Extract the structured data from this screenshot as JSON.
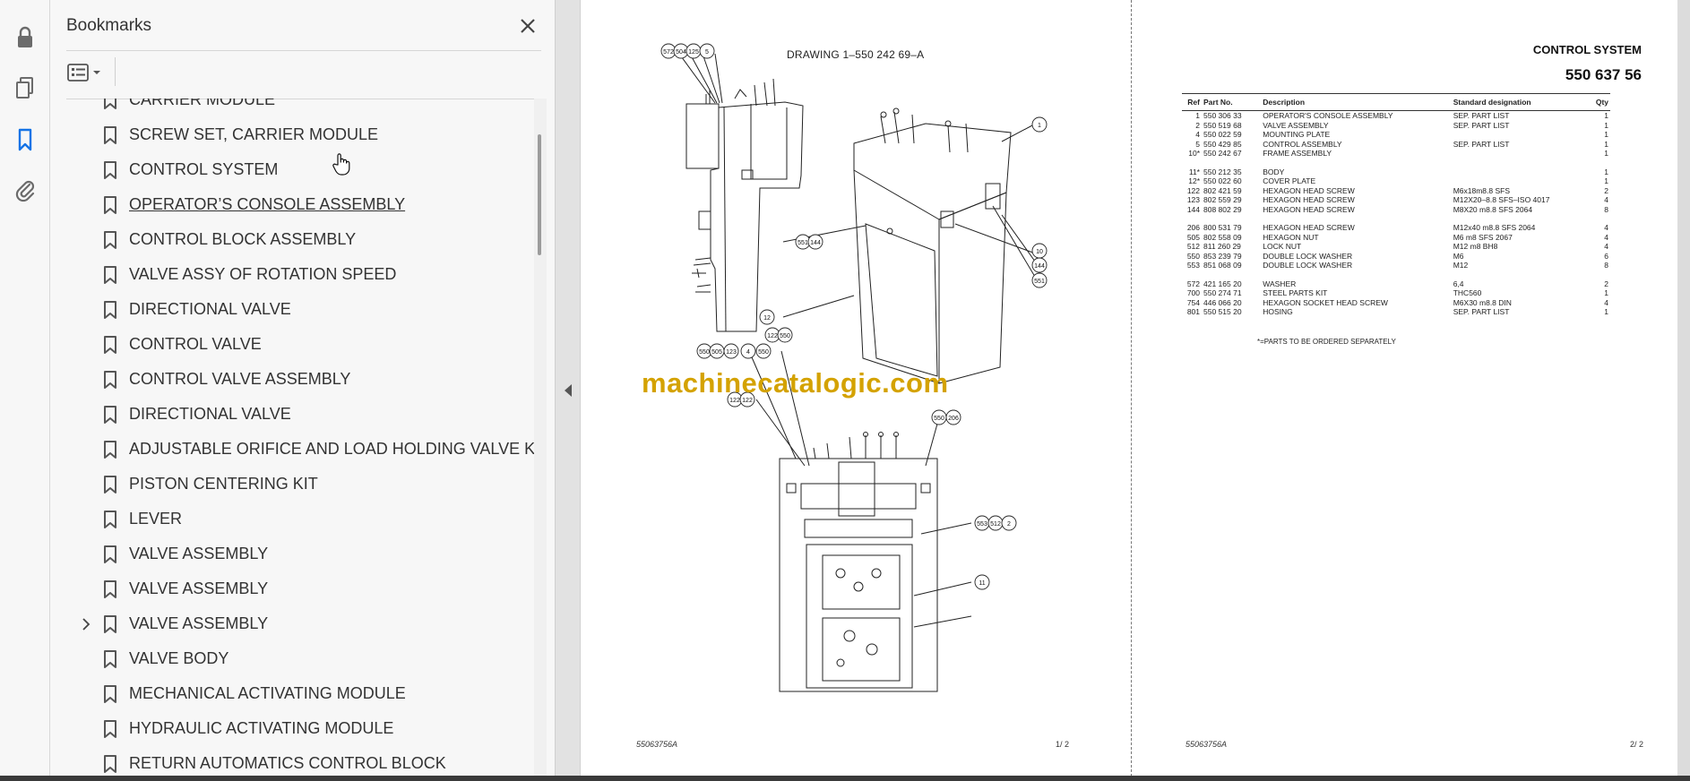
{
  "panel": {
    "title": "Bookmarks",
    "items": [
      {
        "label": "CARRIER MODULE",
        "expandable": false,
        "underline": false
      },
      {
        "label": "SCREW SET, CARRIER MODULE",
        "expandable": false,
        "underline": false
      },
      {
        "label": "CONTROL SYSTEM",
        "expandable": false,
        "underline": false
      },
      {
        "label": "OPERATOR’S CONSOLE ASSEMBLY",
        "expandable": false,
        "underline": true
      },
      {
        "label": "CONTROL BLOCK ASSEMBLY",
        "expandable": false,
        "underline": false
      },
      {
        "label": "VALVE ASSY OF ROTATION SPEED",
        "expandable": false,
        "underline": false
      },
      {
        "label": "DIRECTIONAL VALVE",
        "expandable": false,
        "underline": false
      },
      {
        "label": "CONTROL VALVE",
        "expandable": false,
        "underline": false
      },
      {
        "label": "CONTROL VALVE ASSEMBLY",
        "expandable": false,
        "underline": false
      },
      {
        "label": "DIRECTIONAL VALVE",
        "expandable": false,
        "underline": false
      },
      {
        "label": "ADJUSTABLE ORIFICE AND LOAD HOLDING VALVE KIT",
        "expandable": false,
        "underline": false
      },
      {
        "label": "PISTON CENTERING KIT",
        "expandable": false,
        "underline": false
      },
      {
        "label": "LEVER",
        "expandable": false,
        "underline": false
      },
      {
        "label": "VALVE ASSEMBLY",
        "expandable": false,
        "underline": false
      },
      {
        "label": "VALVE ASSEMBLY",
        "expandable": false,
        "underline": false
      },
      {
        "label": "VALVE ASSEMBLY",
        "expandable": true,
        "underline": false
      },
      {
        "label": "VALVE BODY",
        "expandable": false,
        "underline": false
      },
      {
        "label": "MECHANICAL ACTIVATING MODULE",
        "expandable": false,
        "underline": false
      },
      {
        "label": "HYDRAULIC ACTIVATING MODULE",
        "expandable": false,
        "underline": false
      },
      {
        "label": "RETURN AUTOMATICS CONTROL BLOCK",
        "expandable": false,
        "underline": false
      }
    ]
  },
  "page1": {
    "drawing_title": "DRAWING 1–550 242 69–A",
    "footer_code": "55063756A",
    "footer_page": "1/ 2",
    "watermark": "machinecatalogic.com",
    "callouts": [
      "572",
      "504",
      "125",
      "5",
      "1",
      "551",
      "144",
      "10",
      "144",
      "551",
      "12",
      "122",
      "550",
      "550",
      "505",
      "123",
      "4",
      "550",
      "122",
      "122",
      "550",
      "206",
      "553",
      "512",
      "2",
      "11"
    ]
  },
  "page2": {
    "title": "CONTROL SYSTEM",
    "number": "550 637 56",
    "footer_code": "55063756A",
    "footer_page": "2/ 2",
    "note": "*=PARTS TO BE ORDERED SEPARATELY",
    "table": {
      "headers": [
        "Ref",
        "Part No.",
        "Description",
        "Standard designation",
        "Qty"
      ],
      "groups": [
        [
          [
            "1",
            "550 306 33",
            "OPERATOR'S CONSOLE ASSEMBLY",
            "SEP. PART LIST",
            "1"
          ],
          [
            "2",
            "550 519 68",
            "VALVE ASSEMBLY",
            "SEP. PART LIST",
            "1"
          ],
          [
            "4",
            "550 022 59",
            "MOUNTING PLATE",
            "",
            "1"
          ],
          [
            "5",
            "550 429 85",
            "CONTROL ASSEMBLY",
            "SEP. PART LIST",
            "1"
          ],
          [
            "10*",
            "550 242 67",
            "FRAME ASSEMBLY",
            "",
            "1"
          ]
        ],
        [
          [
            "11*",
            "550 212 35",
            "BODY",
            "",
            "1"
          ],
          [
            "12*",
            "550 022 60",
            "COVER PLATE",
            "",
            "1"
          ],
          [
            "122",
            "802 421 59",
            "HEXAGON HEAD SCREW",
            "M6x18m8.8 SFS",
            "2"
          ],
          [
            "123",
            "802 559 29",
            "HEXAGON HEAD SCREW",
            "M12X20–8.8 SFS–ISO 4017",
            "4"
          ],
          [
            "144",
            "808 802 29",
            "HEXAGON HEAD SCREW",
            "M8X20 m8.8 SFS 2064",
            "8"
          ]
        ],
        [
          [
            "206",
            "800 531 79",
            "HEXAGON HEAD SCREW",
            "M12x40 m8.8 SFS 2064",
            "4"
          ],
          [
            "505",
            "802 558 09",
            "HEXAGON NUT",
            "M6 m8 SFS 2067",
            "4"
          ],
          [
            "512",
            "811 260 29",
            "LOCK NUT",
            "M12 m8 BH8",
            "4"
          ],
          [
            "550",
            "853 239 79",
            "DOUBLE LOCK WASHER",
            "M6",
            "6"
          ],
          [
            "553",
            "851 068 09",
            "DOUBLE LOCK WASHER",
            "M12",
            "8"
          ]
        ],
        [
          [
            "572",
            "421 165 20",
            "WASHER",
            "6,4",
            "2"
          ],
          [
            "700",
            "550 274 71",
            "STEEL PARTS KIT",
            "THC560",
            "1"
          ],
          [
            "754",
            "446 066 20",
            "HEXAGON SOCKET HEAD SCREW",
            "M6X30 m8.8 DIN",
            "4"
          ],
          [
            "801",
            "550 515 20",
            "HOSING",
            "SEP. PART LIST",
            "1"
          ]
        ]
      ]
    }
  }
}
